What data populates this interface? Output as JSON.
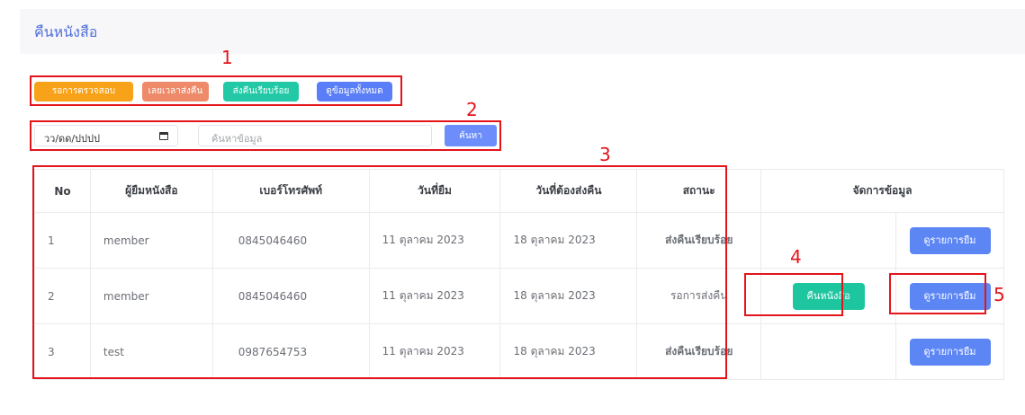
{
  "page": {
    "title": "คืนหนังสือ"
  },
  "filters": [
    {
      "label": "รอการตรวจสอบ",
      "color": "#f8a21a"
    },
    {
      "label": "เลยเวลาส่งคืน",
      "color": "#ee8a6a"
    },
    {
      "label": "ส่งคืนเรียบร้อย",
      "color": "#23c9a6"
    },
    {
      "label": "ดูข้อมูลทั้งหมด",
      "color": "#5a7ef7"
    }
  ],
  "search": {
    "date_placeholder": "วว/ดด/ปปปป",
    "placeholder": "ค้นหาข้อมูล",
    "button_label": "ค้นหา"
  },
  "table": {
    "headers": [
      "No",
      "ผู้ยืมหนังสือ",
      "เบอร์โทรศัพท์",
      "วันที่ยืม",
      "วันที่ต้องส่งคืน",
      "สถานะ",
      "จัดการข้อมูล"
    ],
    "rows": [
      {
        "no": "1",
        "name": "member",
        "phone": "0845046460",
        "borrow_date": "11 ตุลาคม 2023",
        "due_date": "18 ตุลาคม 2023",
        "status": "ส่งคืนเรียบร้อย",
        "status_color": "#2e8b1f",
        "return_label": "",
        "view_label": "ดูรายการยืม"
      },
      {
        "no": "2",
        "name": "member",
        "phone": "0845046460",
        "borrow_date": "11 ตุลาคม 2023",
        "due_date": "18 ตุลาคม 2023",
        "status": "รอการส่งคืน",
        "status_color": "#f2a93b",
        "return_label": "คืนหนังสือ",
        "view_label": "ดูรายการยืม"
      },
      {
        "no": "3",
        "name": "test",
        "phone": "0987654753",
        "borrow_date": "11 ตุลาคม 2023",
        "due_date": "18 ตุลาคม 2023",
        "status": "ส่งคืนเรียบร้อย",
        "status_color": "#2e8b1f",
        "return_label": "",
        "view_label": "ดูรายการยืม"
      }
    ]
  },
  "annotations": [
    "1",
    "2",
    "3",
    "4",
    "5"
  ],
  "colors": {
    "annotation": "#e4141b",
    "accent": "#5d86f5",
    "return_button": "#1ec6a0"
  }
}
